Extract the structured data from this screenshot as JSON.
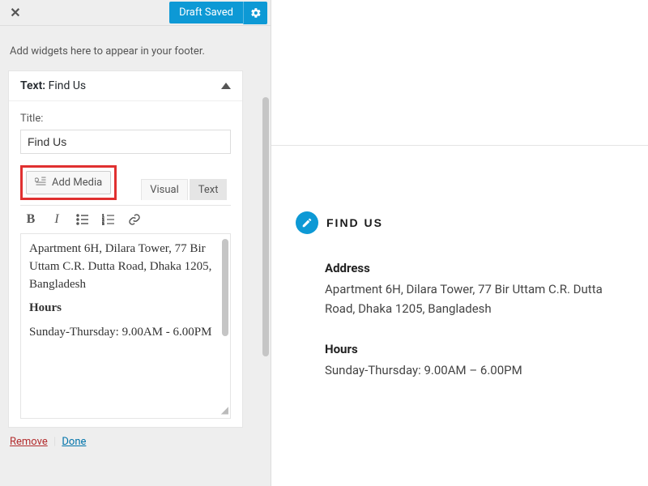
{
  "header": {
    "draft_saved": "Draft Saved"
  },
  "sidebar": {
    "intro": "Add widgets here to appear in your footer.",
    "widget": {
      "type_label": "Text:",
      "name": "Find Us",
      "title_label": "Title:",
      "title_value": "Find Us",
      "add_media": "Add Media",
      "tabs": {
        "visual": "Visual",
        "text": "Text"
      },
      "content": {
        "address_text": "Apartment 6H, Dilara Tower, 77 Bir Uttam C.R. Dutta Road, Dhaka 1205, Bangladesh",
        "hours_label": "Hours",
        "hours_text": "Sunday-Thursday: 9.00AM -  6.00PM"
      }
    },
    "footer": {
      "remove": "Remove",
      "done": "Done"
    }
  },
  "preview": {
    "title": "FIND US",
    "sections": {
      "address_label": "Address",
      "address_text": "Apartment 6H, Dilara Tower, 77 Bir Uttam C.R. Dutta Road, Dhaka 1205, Bangladesh",
      "hours_label": "Hours",
      "hours_text": "Sunday-Thursday: 9.00AM –  6.00PM"
    }
  }
}
